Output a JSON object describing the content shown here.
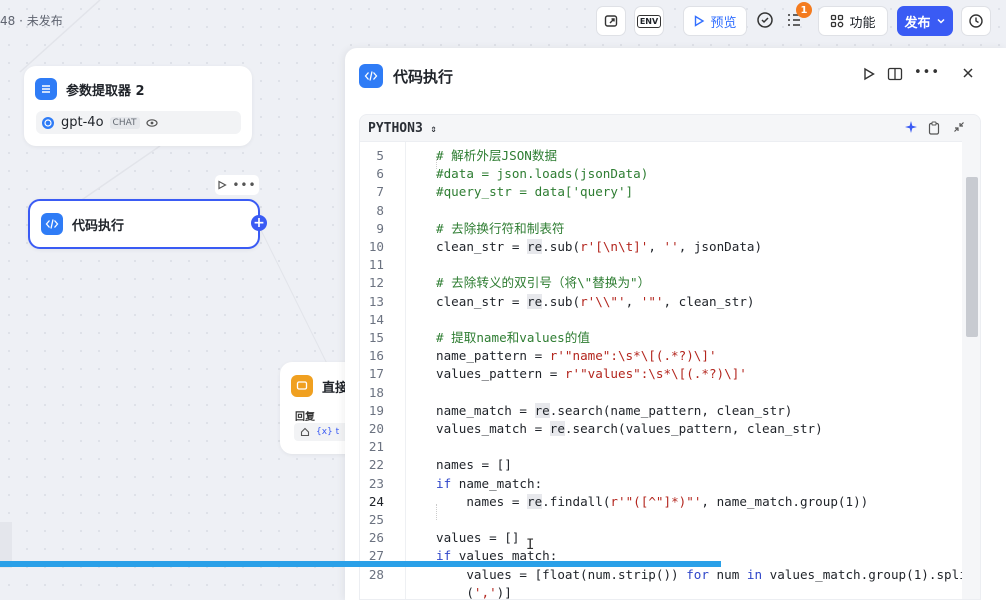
{
  "status": {
    "text": "48 · 未发布"
  },
  "toolbar": {
    "env_label": "ENV",
    "preview_label": "预览",
    "badge_count": "1",
    "features_label": "功能",
    "publish_label": "发布"
  },
  "nodes": {
    "param_extractor": {
      "title": "参数提取器 2",
      "model": "gpt-4o",
      "model_tag": "CHAT"
    },
    "code_exec": {
      "title": "代码执行"
    },
    "direct_reply": {
      "title": "直接",
      "field_label": "回复",
      "var_prefix": "{x} t"
    }
  },
  "panel": {
    "title": "代码执行",
    "language": "PYTHON3"
  },
  "code": {
    "lines": [
      {
        "n": "5",
        "t": "# 解析外层JSON数据"
      },
      {
        "n": "6",
        "t": "#data = json.loads(jsonData)"
      },
      {
        "n": "7",
        "t": "#query_str = data['query']"
      },
      {
        "n": "8",
        "t": ""
      },
      {
        "n": "9",
        "t": "# 去除换行符和制表符"
      },
      {
        "n": "10",
        "t": "clean_str = re.sub(r'[\\n\\t]', '', jsonData)"
      },
      {
        "n": "11",
        "t": ""
      },
      {
        "n": "12",
        "t": "# 去除转义的双引号（将\\\"替换为\"）"
      },
      {
        "n": "13",
        "t": "clean_str = re.sub(r'\\\\\"', '\"', clean_str)"
      },
      {
        "n": "14",
        "t": ""
      },
      {
        "n": "15",
        "t": "# 提取name和values的值"
      },
      {
        "n": "16",
        "t": "name_pattern = r'\"name\":\\s*\\[(.*?)\\]'"
      },
      {
        "n": "17",
        "t": "values_pattern = r'\"values\":\\s*\\[(.*?)\\]'"
      },
      {
        "n": "18",
        "t": ""
      },
      {
        "n": "19",
        "t": "name_match = re.search(name_pattern, clean_str)"
      },
      {
        "n": "20",
        "t": "values_match = re.search(values_pattern, clean_str)"
      },
      {
        "n": "21",
        "t": ""
      },
      {
        "n": "22",
        "t": "names = []"
      },
      {
        "n": "23",
        "t": "if name_match:"
      },
      {
        "n": "24",
        "t": "    names = re.findall(r'\"([^\"]*)\"', name_match.group(1))"
      },
      {
        "n": "25",
        "t": ""
      },
      {
        "n": "26",
        "t": "values = []"
      },
      {
        "n": "27",
        "t": "if values_match:"
      },
      {
        "n": "28",
        "t": "    values = [float(num.strip()) for num in values_match.group(1).split"
      },
      {
        "n": "",
        "t": "    (',')]"
      }
    ]
  },
  "colors": {
    "accent": "#3a5bf4",
    "progress": "#2aa0e8",
    "comment": "#2e7d32",
    "keyword": "#2f46c9",
    "string": "#b3261e"
  }
}
